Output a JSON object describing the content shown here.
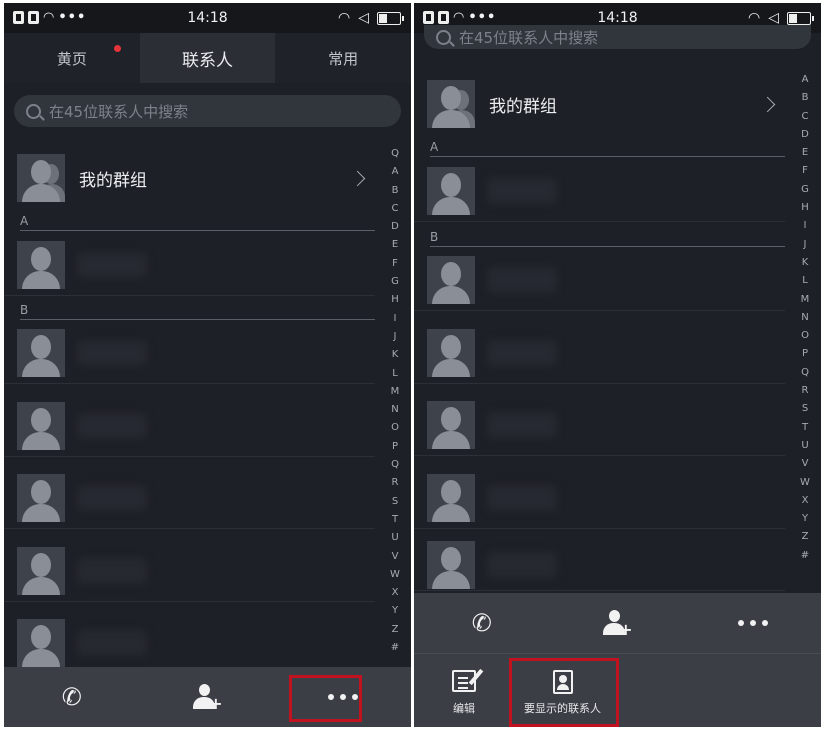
{
  "status": {
    "time": "14:18",
    "dots": "•••"
  },
  "tabs": [
    {
      "label": "黄页",
      "badge_color": "#e5333a"
    },
    {
      "label": "联系人"
    },
    {
      "label": "常用"
    }
  ],
  "search": {
    "placeholder": "在45位联系人中搜索"
  },
  "group": {
    "label": "我的群组"
  },
  "sections": {
    "a": "A",
    "b": "B"
  },
  "index_letters": [
    "Q",
    "A",
    "B",
    "C",
    "D",
    "E",
    "F",
    "G",
    "H",
    "I",
    "J",
    "K",
    "L",
    "M",
    "N",
    "O",
    "P",
    "Q",
    "R",
    "S",
    "T",
    "U",
    "V",
    "W",
    "X",
    "Y",
    "Z",
    "#"
  ],
  "bottom_bar": {
    "call_icon": "phone-icon",
    "add_icon": "add-contact-icon",
    "more_icon": "more-icon"
  },
  "menu": {
    "edit_label": "编辑",
    "display_label": "要显示的联系人"
  },
  "colors": {
    "background": "#1d2026",
    "bar": "#3b3e45",
    "highlight": "#c1121f",
    "badge": "#e5333a"
  }
}
